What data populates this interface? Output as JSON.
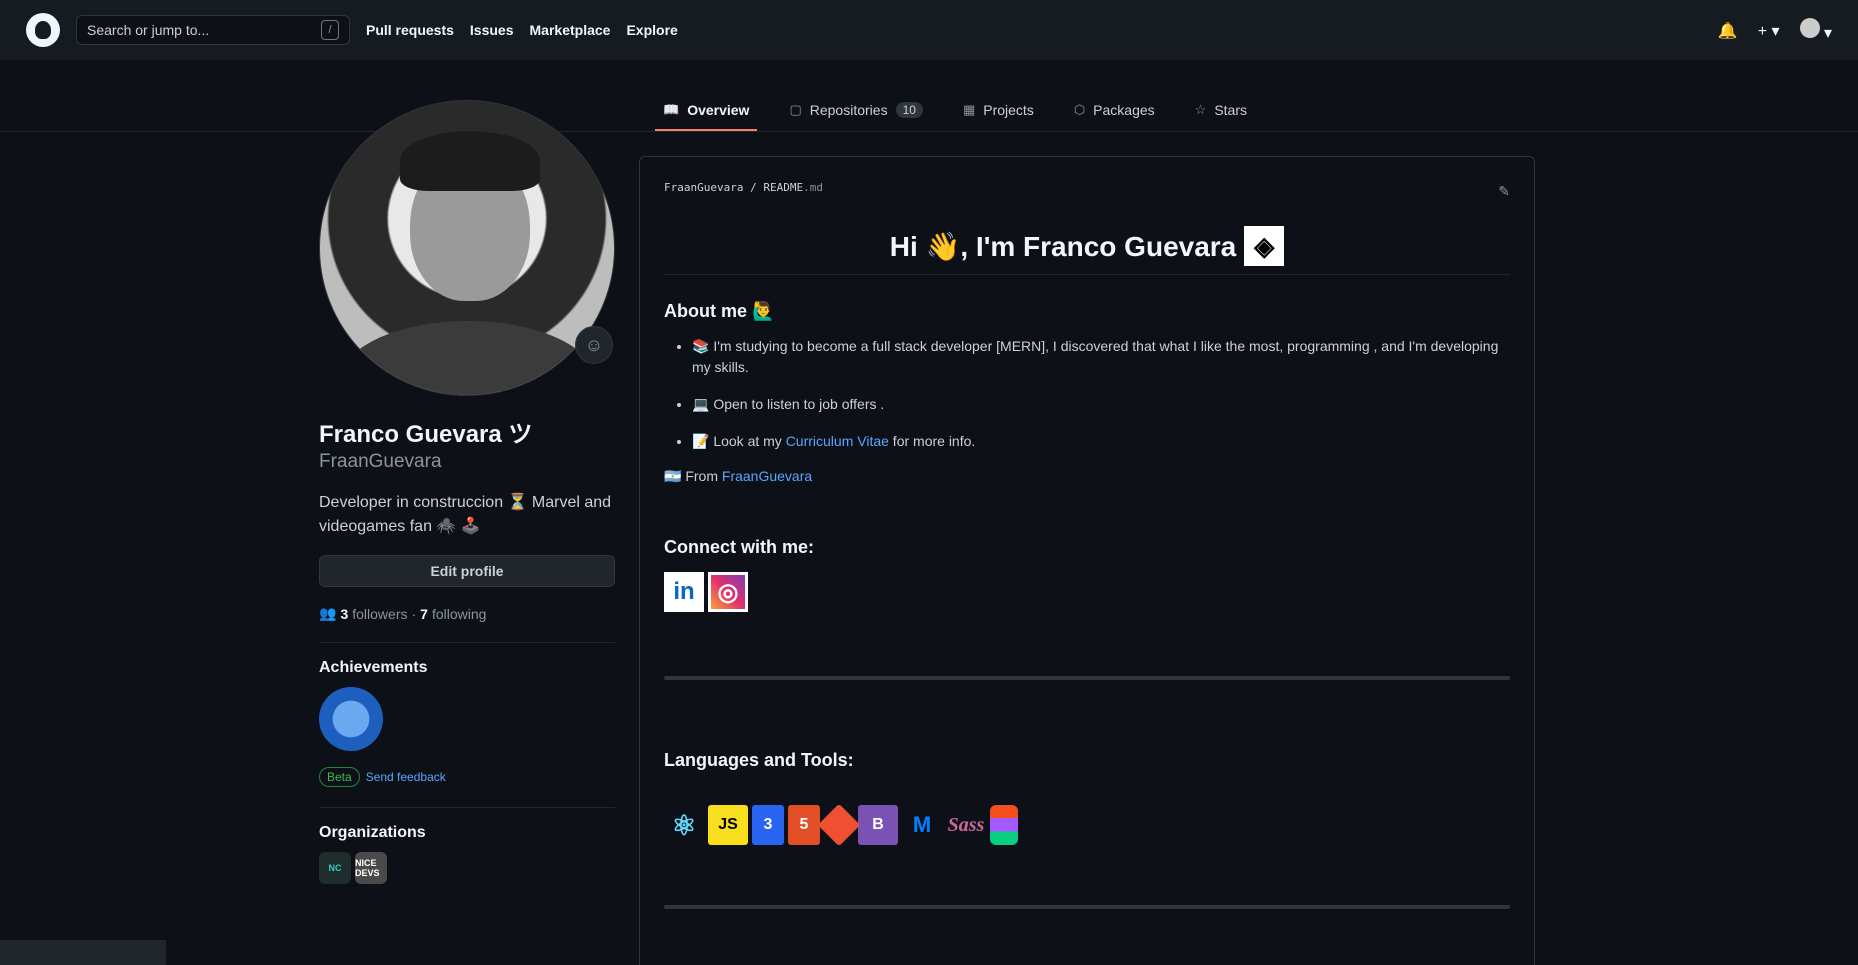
{
  "header": {
    "search_placeholder": "Search or jump to...",
    "search_shortcut": "/",
    "nav": [
      "Pull requests",
      "Issues",
      "Marketplace",
      "Explore"
    ],
    "plus": "+ ▾",
    "bell": "🔔",
    "avatar_caret": "▾"
  },
  "tabs": {
    "overview": "Overview",
    "repositories": "Repositories",
    "repositories_count": "10",
    "projects": "Projects",
    "packages": "Packages",
    "stars": "Stars"
  },
  "profile": {
    "full_name": "Franco Guevara ツ",
    "username": "FraanGuevara",
    "bio": "Developer in construccion ⏳ Marvel and videogames fan 🕷️ 🕹️",
    "edit_label": "Edit profile",
    "followers_count": "3",
    "followers_label": "followers",
    "sep": "·",
    "following_count": "7",
    "following_label": "following",
    "achievements_title": "Achievements",
    "beta_label": "Beta",
    "feedback_label": "Send feedback",
    "organizations_title": "Organizations",
    "org1": "NC",
    "org2": "NICE DEVS"
  },
  "readme": {
    "owner": "FraanGuevara",
    "slash": "/",
    "file": "README",
    "ext": ".md",
    "greeting": "Hi 👋, I'm Franco Guevara",
    "about_title": "About me 🙋‍♂️",
    "item1": "📚 I'm studying to become a full stack developer [MERN], I discovered that what I like the most, programming , and I'm developing my skills.",
    "item2": "💻 Open to listen to job offers .",
    "item3_pre": "📝 Look at my ",
    "item3_link": "Curriculum Vitae",
    "item3_post": " for more info.",
    "from_pre": "From ",
    "from_link": "FraanGuevara",
    "connect_title": "Connect with me:",
    "languages_title": "Languages and Tools:"
  },
  "tools": [
    "React",
    "JS",
    "CSS3",
    "HTML5",
    "Git",
    "Bootstrap",
    "MUI",
    "Sass",
    "Figma"
  ],
  "colors": {
    "accent": "#f78166",
    "link": "#58a6ff",
    "background": "#0d1117",
    "header": "#161b22"
  }
}
